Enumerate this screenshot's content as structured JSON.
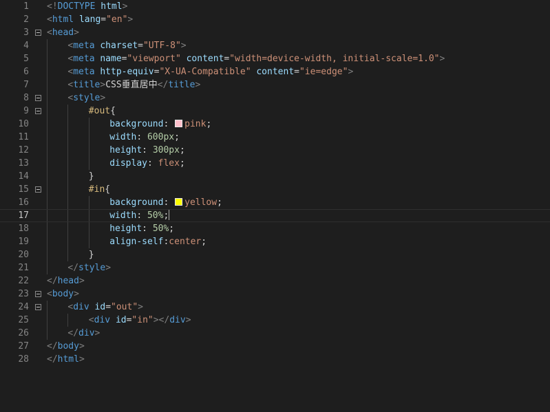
{
  "editor": {
    "theme": {
      "background": "#1e1e1e",
      "line_number": "#858585",
      "tag": "#569cd6",
      "attribute": "#9cdcfe",
      "string": "#ce9178",
      "selector": "#d7ba7d",
      "number": "#b5cea8",
      "punctuation": "#808080",
      "text": "#d4d4d4"
    },
    "current_line": 17,
    "lines": [
      {
        "n": "1",
        "fold": false,
        "indent": 0,
        "tokens": [
          [
            "punct",
            "<!"
          ],
          [
            "tag",
            "DOCTYPE"
          ],
          [
            "text",
            " "
          ],
          [
            "attr",
            "html"
          ],
          [
            "punct",
            ">"
          ]
        ]
      },
      {
        "n": "2",
        "fold": false,
        "indent": 0,
        "tokens": [
          [
            "punct",
            "<"
          ],
          [
            "tag",
            "html"
          ],
          [
            "text",
            " "
          ],
          [
            "attr",
            "lang"
          ],
          [
            "text",
            "="
          ],
          [
            "str",
            "\"en\""
          ],
          [
            "punct",
            ">"
          ]
        ]
      },
      {
        "n": "3",
        "fold": true,
        "indent": 0,
        "tokens": [
          [
            "punct",
            "<"
          ],
          [
            "tag",
            "head"
          ],
          [
            "punct",
            ">"
          ]
        ]
      },
      {
        "n": "4",
        "fold": false,
        "indent": 1,
        "tokens": [
          [
            "punct",
            "<"
          ],
          [
            "tag",
            "meta"
          ],
          [
            "text",
            " "
          ],
          [
            "attr",
            "charset"
          ],
          [
            "text",
            "="
          ],
          [
            "str",
            "\"UTF-8\""
          ],
          [
            "punct",
            ">"
          ]
        ]
      },
      {
        "n": "5",
        "fold": false,
        "indent": 1,
        "tokens": [
          [
            "punct",
            "<"
          ],
          [
            "tag",
            "meta"
          ],
          [
            "text",
            " "
          ],
          [
            "attr",
            "name"
          ],
          [
            "text",
            "="
          ],
          [
            "str",
            "\"viewport\""
          ],
          [
            "text",
            " "
          ],
          [
            "attr",
            "content"
          ],
          [
            "text",
            "="
          ],
          [
            "str",
            "\"width=device-width, initial-scale=1.0\""
          ],
          [
            "punct",
            ">"
          ]
        ]
      },
      {
        "n": "6",
        "fold": false,
        "indent": 1,
        "tokens": [
          [
            "punct",
            "<"
          ],
          [
            "tag",
            "meta"
          ],
          [
            "text",
            " "
          ],
          [
            "attr",
            "http-equiv"
          ],
          [
            "text",
            "="
          ],
          [
            "str",
            "\"X-UA-Compatible\""
          ],
          [
            "text",
            " "
          ],
          [
            "attr",
            "content"
          ],
          [
            "text",
            "="
          ],
          [
            "str",
            "\"ie=edge\""
          ],
          [
            "punct",
            ">"
          ]
        ]
      },
      {
        "n": "7",
        "fold": false,
        "indent": 1,
        "tokens": [
          [
            "punct",
            "<"
          ],
          [
            "tag",
            "title"
          ],
          [
            "punct",
            ">"
          ],
          [
            "text",
            "CSS垂直居中"
          ],
          [
            "punct",
            "</"
          ],
          [
            "tag",
            "title"
          ],
          [
            "punct",
            ">"
          ]
        ]
      },
      {
        "n": "8",
        "fold": true,
        "indent": 1,
        "tokens": [
          [
            "punct",
            "<"
          ],
          [
            "tag",
            "style"
          ],
          [
            "punct",
            ">"
          ]
        ]
      },
      {
        "n": "9",
        "fold": true,
        "indent": 2,
        "tokens": [
          [
            "sel",
            "#out"
          ],
          [
            "plain",
            "{"
          ]
        ]
      },
      {
        "n": "10",
        "fold": false,
        "indent": 3,
        "tokens": [
          [
            "prop",
            "background"
          ],
          [
            "plain",
            ": "
          ],
          [
            "swatch",
            "pink"
          ],
          [
            "val",
            "pink"
          ],
          [
            "plain",
            ";"
          ]
        ]
      },
      {
        "n": "11",
        "fold": false,
        "indent": 3,
        "tokens": [
          [
            "prop",
            "width"
          ],
          [
            "plain",
            ": "
          ],
          [
            "num",
            "600px"
          ],
          [
            "plain",
            ";"
          ]
        ]
      },
      {
        "n": "12",
        "fold": false,
        "indent": 3,
        "tokens": [
          [
            "prop",
            "height"
          ],
          [
            "plain",
            ": "
          ],
          [
            "num",
            "300px"
          ],
          [
            "plain",
            ";"
          ]
        ]
      },
      {
        "n": "13",
        "fold": false,
        "indent": 3,
        "tokens": [
          [
            "prop",
            "display"
          ],
          [
            "plain",
            ": "
          ],
          [
            "val",
            "flex"
          ],
          [
            "plain",
            ";"
          ]
        ]
      },
      {
        "n": "14",
        "fold": false,
        "indent": 2,
        "tokens": [
          [
            "plain",
            "}"
          ]
        ]
      },
      {
        "n": "15",
        "fold": true,
        "indent": 2,
        "tokens": [
          [
            "sel",
            "#in"
          ],
          [
            "plain",
            "{"
          ]
        ]
      },
      {
        "n": "16",
        "fold": false,
        "indent": 3,
        "tokens": [
          [
            "prop",
            "background"
          ],
          [
            "plain",
            ": "
          ],
          [
            "swatch",
            "yellow"
          ],
          [
            "val",
            "yellow"
          ],
          [
            "plain",
            ";"
          ]
        ]
      },
      {
        "n": "17",
        "fold": false,
        "indent": 3,
        "tokens": [
          [
            "prop",
            "width"
          ],
          [
            "plain",
            ": "
          ],
          [
            "num",
            "50%"
          ],
          [
            "plain",
            ";"
          ],
          [
            "cursor",
            ""
          ]
        ]
      },
      {
        "n": "18",
        "fold": false,
        "indent": 3,
        "tokens": [
          [
            "prop",
            "height"
          ],
          [
            "plain",
            ": "
          ],
          [
            "num",
            "50%"
          ],
          [
            "plain",
            ";"
          ]
        ]
      },
      {
        "n": "19",
        "fold": false,
        "indent": 3,
        "tokens": [
          [
            "prop",
            "align-self"
          ],
          [
            "plain",
            ":"
          ],
          [
            "val",
            "center"
          ],
          [
            "plain",
            ";"
          ]
        ]
      },
      {
        "n": "20",
        "fold": false,
        "indent": 2,
        "tokens": [
          [
            "plain",
            "}"
          ]
        ]
      },
      {
        "n": "21",
        "fold": false,
        "indent": 1,
        "tokens": [
          [
            "punct",
            "</"
          ],
          [
            "tag",
            "style"
          ],
          [
            "punct",
            ">"
          ]
        ]
      },
      {
        "n": "22",
        "fold": false,
        "indent": 0,
        "tokens": [
          [
            "punct",
            "</"
          ],
          [
            "tag",
            "head"
          ],
          [
            "punct",
            ">"
          ]
        ]
      },
      {
        "n": "23",
        "fold": true,
        "indent": 0,
        "tokens": [
          [
            "punct",
            "<"
          ],
          [
            "tag",
            "body"
          ],
          [
            "punct",
            ">"
          ]
        ]
      },
      {
        "n": "24",
        "fold": true,
        "indent": 1,
        "tokens": [
          [
            "punct",
            "<"
          ],
          [
            "tag",
            "div"
          ],
          [
            "text",
            " "
          ],
          [
            "attr",
            "id"
          ],
          [
            "text",
            "="
          ],
          [
            "str",
            "\"out\""
          ],
          [
            "punct",
            ">"
          ]
        ]
      },
      {
        "n": "25",
        "fold": false,
        "indent": 2,
        "tokens": [
          [
            "punct",
            "<"
          ],
          [
            "tag",
            "div"
          ],
          [
            "text",
            " "
          ],
          [
            "attr",
            "id"
          ],
          [
            "text",
            "="
          ],
          [
            "str",
            "\"in\""
          ],
          [
            "punct",
            "></"
          ],
          [
            "tag",
            "div"
          ],
          [
            "punct",
            ">"
          ]
        ]
      },
      {
        "n": "26",
        "fold": false,
        "indent": 1,
        "tokens": [
          [
            "punct",
            "</"
          ],
          [
            "tag",
            "div"
          ],
          [
            "punct",
            ">"
          ]
        ]
      },
      {
        "n": "27",
        "fold": false,
        "indent": 0,
        "tokens": [
          [
            "punct",
            "</"
          ],
          [
            "tag",
            "body"
          ],
          [
            "punct",
            ">"
          ]
        ]
      },
      {
        "n": "28",
        "fold": false,
        "indent": 0,
        "tokens": [
          [
            "punct",
            "</"
          ],
          [
            "tag",
            "html"
          ],
          [
            "punct",
            ">"
          ]
        ]
      }
    ]
  }
}
